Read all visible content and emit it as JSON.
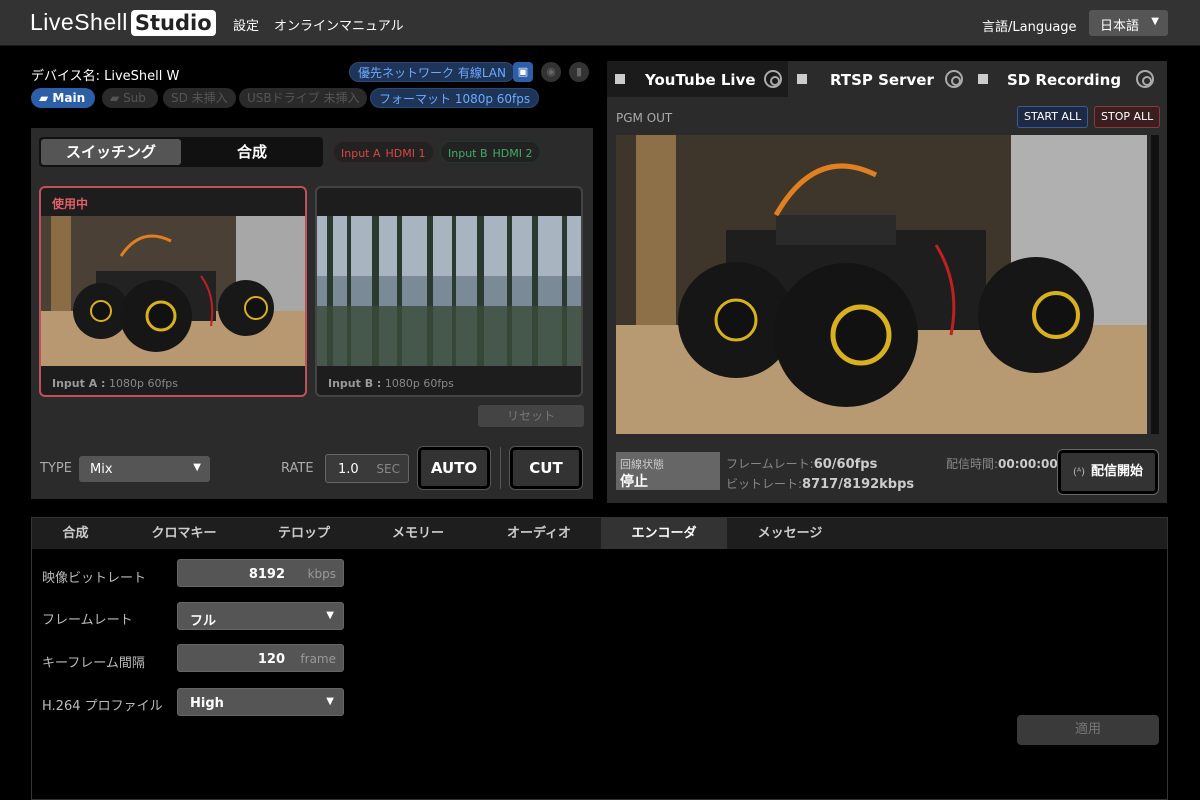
{
  "app": {
    "logo_text": "LiveShell",
    "logo_box": "Studio"
  },
  "topnav": {
    "settings": "設定",
    "manual": "オンラインマニュアル",
    "language_label": "言語/Language",
    "language_value": "日本語"
  },
  "device": {
    "name_label": "デバイス名: LiveShell W",
    "network": "優先ネットワーク 有線LAN",
    "main": "Main",
    "sub": "Sub",
    "sd": "SD 未挿入",
    "usb": "USBドライブ 未挿入",
    "format": "フォーマット 1080p 60fps"
  },
  "switcher": {
    "mode_switching": "スイッチング",
    "mode_compose": "合成",
    "input_a_label": "Input A",
    "input_a_src": "HDMI 1",
    "input_b_label": "Input B",
    "input_b_src": "HDMI 2",
    "card_a_tag": "使用中",
    "card_a_cap_name": "Input A :",
    "card_a_cap_fmt": "1080p 60fps",
    "card_b_cap_name": "Input B :",
    "card_b_cap_fmt": "1080p 60fps",
    "reset": "リセット",
    "type_label": "TYPE",
    "type_value": "Mix",
    "rate_label": "RATE",
    "rate_value": "1.0",
    "rate_unit": "SEC",
    "auto": "AUTO",
    "cut": "CUT"
  },
  "output": {
    "tabs": [
      {
        "label": "YouTube Live"
      },
      {
        "label": "RTSP Server"
      },
      {
        "label": "SD Recording"
      }
    ],
    "pgm_label": "PGM OUT",
    "start_all": "START ALL",
    "stop_all": "STOP ALL",
    "line_state_label": "回線状態",
    "line_state_value": "停止",
    "framerate_label": "フレームレート:",
    "framerate_value": "60/60fps",
    "bitrate_label": "ビットレート:",
    "bitrate_value": "8717/8192kbps",
    "time_label": "配信時間:",
    "time_value": "00:00:00",
    "go_live": "配信開始",
    "go_live_icon": "(ᴬ)"
  },
  "settings": {
    "tabs": [
      "合成",
      "クロマキー",
      "テロップ",
      "メモリー",
      "オーディオ",
      "エンコーダ",
      "メッセージ"
    ],
    "active_tab": "エンコーダ",
    "video_bitrate_label": "映像ビットレート",
    "video_bitrate_value": "8192",
    "video_bitrate_unit": "kbps",
    "framerate_label": "フレームレート",
    "framerate_value": "フル",
    "keyframe_label": "キーフレーム間隔",
    "keyframe_value": "120",
    "keyframe_unit": "frame",
    "profile_label": "H.264 プロファイル",
    "profile_value": "High",
    "apply": "適用"
  },
  "colors": {
    "accent_red": "#c0505a",
    "accent_blue": "#2d5ea8",
    "panel": "#2b2b2b"
  }
}
